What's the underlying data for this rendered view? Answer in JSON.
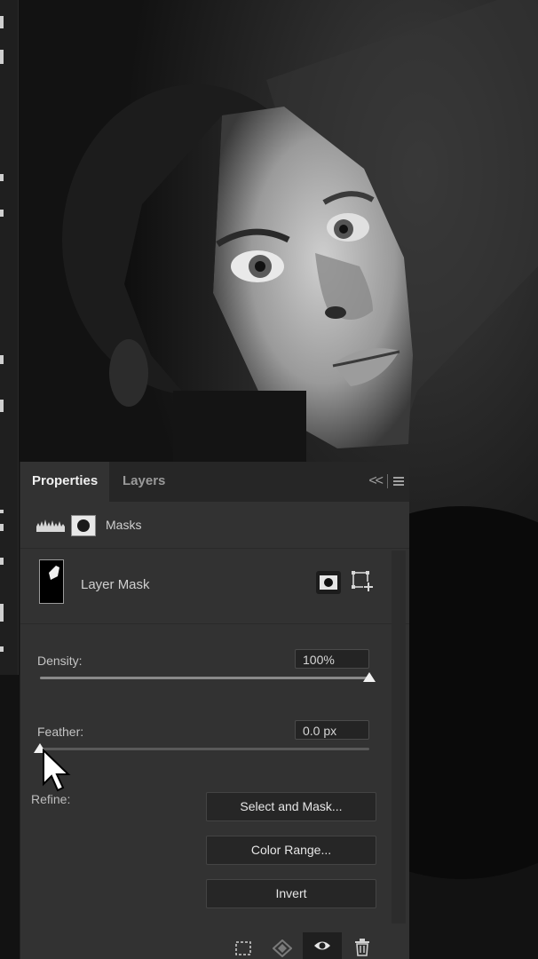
{
  "tabs": {
    "properties": "Properties",
    "layers": "Layers"
  },
  "panel_controls": {
    "collapse": "<<"
  },
  "masks_header": {
    "label": "Masks"
  },
  "layer_mask": {
    "label": "Layer Mask"
  },
  "density": {
    "label": "Density:",
    "value": "100%",
    "level": 1.0
  },
  "feather": {
    "label": "Feather:",
    "value": "0.0 px",
    "level": 0.0
  },
  "refine": {
    "label": "Refine:",
    "buttons": {
      "select_and_mask": "Select and Mask...",
      "color_range": "Color Range...",
      "invert": "Invert"
    }
  },
  "bottom_icons": [
    "load-selection-icon",
    "apply-mask-icon",
    "eye-icon",
    "trash-icon"
  ],
  "colors": {
    "panel_bg": "#323232",
    "tab_bar": "#262626",
    "canvas_bg": "#0d0d0d"
  }
}
